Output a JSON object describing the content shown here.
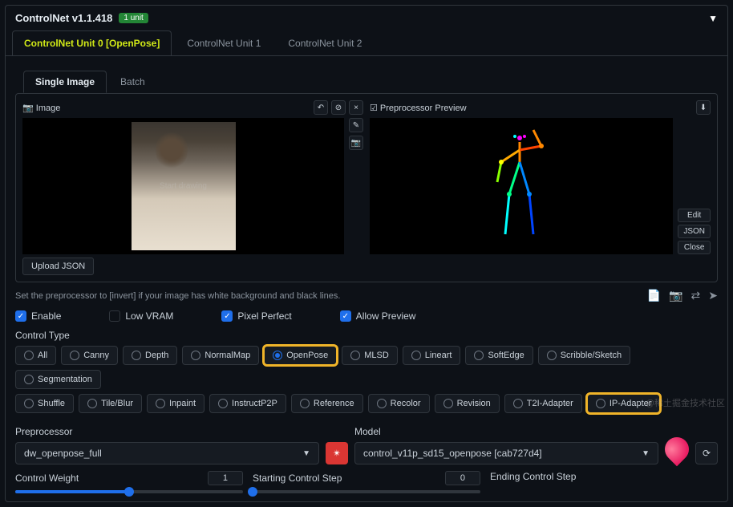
{
  "header": {
    "title": "ControlNet v1.1.418",
    "badge": "1 unit"
  },
  "tabs": [
    "ControlNet Unit 0 [OpenPose]",
    "ControlNet Unit 1",
    "ControlNet Unit 2"
  ],
  "subtabs": [
    "Single Image",
    "Batch"
  ],
  "image_label": "Image",
  "watermark_img": "Start drawing",
  "preview_label": "Preprocessor Preview",
  "upload_label": "Upload JSON",
  "side_buttons": [
    "Edit",
    "JSON",
    "Close"
  ],
  "hint": "Set the preprocessor to [invert] if your image has white background and black lines.",
  "checks": {
    "enable": "Enable",
    "lowvram": "Low VRAM",
    "pixel": "Pixel Perfect",
    "preview": "Allow Preview"
  },
  "control_type_label": "Control Type",
  "types_r1": [
    "All",
    "Canny",
    "Depth",
    "NormalMap",
    "OpenPose",
    "MLSD",
    "Lineart",
    "SoftEdge",
    "Scribble/Sketch",
    "Segmentation"
  ],
  "types_r2": [
    "Shuffle",
    "Tile/Blur",
    "Inpaint",
    "InstructP2P",
    "Reference",
    "Recolor",
    "Revision",
    "T2I-Adapter",
    "IP-Adapter"
  ],
  "preproc_label": "Preprocessor",
  "preproc_value": "dw_openpose_full",
  "model_label": "Model",
  "model_value": "control_v11p_sd15_openpose [cab727d4]",
  "sliders": {
    "weight": {
      "label": "Control Weight",
      "value": "1"
    },
    "start": {
      "label": "Starting Control Step",
      "value": "0"
    },
    "end": {
      "label": "Ending Control Step"
    }
  },
  "watermark": "@稀土掘金技术社区"
}
